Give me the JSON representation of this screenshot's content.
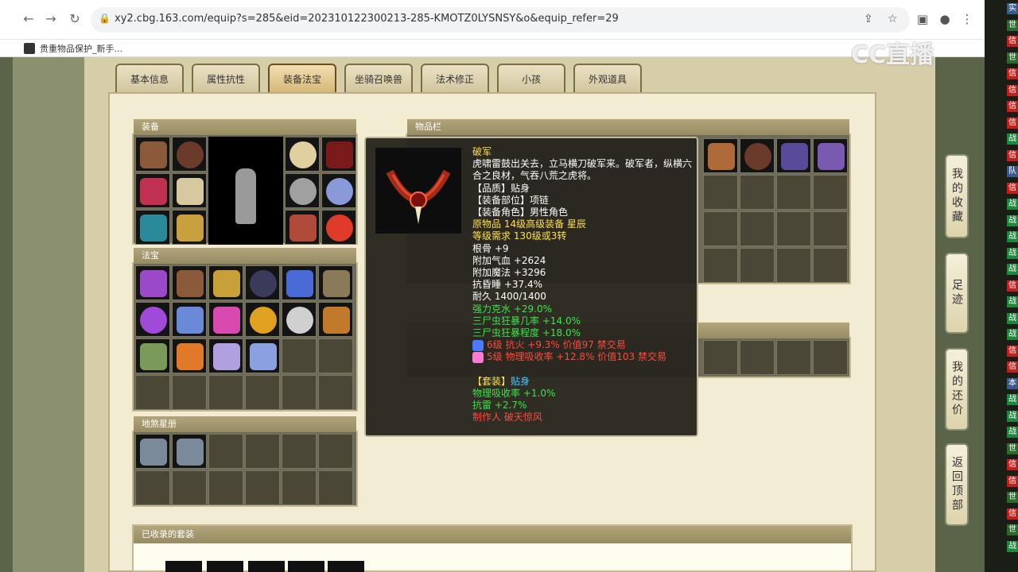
{
  "browser": {
    "url": "xy2.cbg.163.com/equip?s=285&eid=202310122300213-285-KMOTZ0LYSNSY&o&equip_refer=29",
    "bookmark": "贵重物品保护_新手...",
    "watermark": "CC直播"
  },
  "tabs": [
    {
      "label": "基本信息",
      "active": false
    },
    {
      "label": "属性抗性",
      "active": false
    },
    {
      "label": "装备法宝",
      "active": true
    },
    {
      "label": "坐骑召唤兽",
      "active": false
    },
    {
      "label": "法术修正",
      "active": false
    },
    {
      "label": "小孩",
      "active": false
    },
    {
      "label": "外观道具",
      "active": false
    }
  ],
  "sections": {
    "equipment": "装备",
    "magic": "法宝",
    "star_book": "地煞星册",
    "inventory": "物品栏",
    "collected_sets": "已收录的套装"
  },
  "tooltip": {
    "name": "破军",
    "description": "虎啸雷鼓出关去，立马横刀破军来。破军者，纵横六合之良材，气吞八荒之虎将。",
    "quality": "【品质】贴身",
    "slot": "【装备部位】项链",
    "role": "【装备角色】男性角色",
    "origin": "原物品 14级高级装备 星辰",
    "level_req": "等级需求 130级或3转",
    "stats_white": [
      "根骨 +9",
      "附加气血 +2624",
      "附加魔法 +3296",
      "抗昏睡 +37.4%",
      "耐久 1400/1400"
    ],
    "stats_green": [
      "强力克水 +29.0%",
      "三尸虫狂暴几率 +14.0%",
      "三尸虫狂暴程度 +18.0%"
    ],
    "gems": [
      {
        "text": "6级 抗火 +9.3% 价值97 禁交易",
        "color": "#4a7bff"
      },
      {
        "text": "5级 物理吸收率 +12.8% 价值103 禁交易",
        "color": "#ff7ad0"
      }
    ],
    "set_label": "【套装】",
    "set_name": "贴身",
    "set_stats": [
      "物理吸收率 +1.0%",
      "抗雷 +2.7%"
    ],
    "maker": "制作人 破天惊风"
  },
  "side_nav": [
    {
      "label": "我的收藏"
    },
    {
      "label": "足迹"
    },
    {
      "label": "我的还价"
    },
    {
      "label": "返回顶部"
    }
  ],
  "strip_tags": [
    "实",
    "世",
    "信",
    "世",
    "信",
    "信",
    "信",
    "信",
    "战",
    "信",
    "队",
    "信",
    "战",
    "战",
    "战",
    "战",
    "战",
    "信",
    "战",
    "战",
    "战",
    "信",
    "信",
    "本",
    "战",
    "战",
    "战",
    "世",
    "信",
    "信",
    "世",
    "信",
    "世",
    "战"
  ],
  "colors": {
    "tooltip_name": "#ffe14a",
    "stat_white": "#ffffff",
    "stat_green": "#3ce34a",
    "stat_red": "#ff4b3c",
    "set_name": "#4ac8ff"
  }
}
